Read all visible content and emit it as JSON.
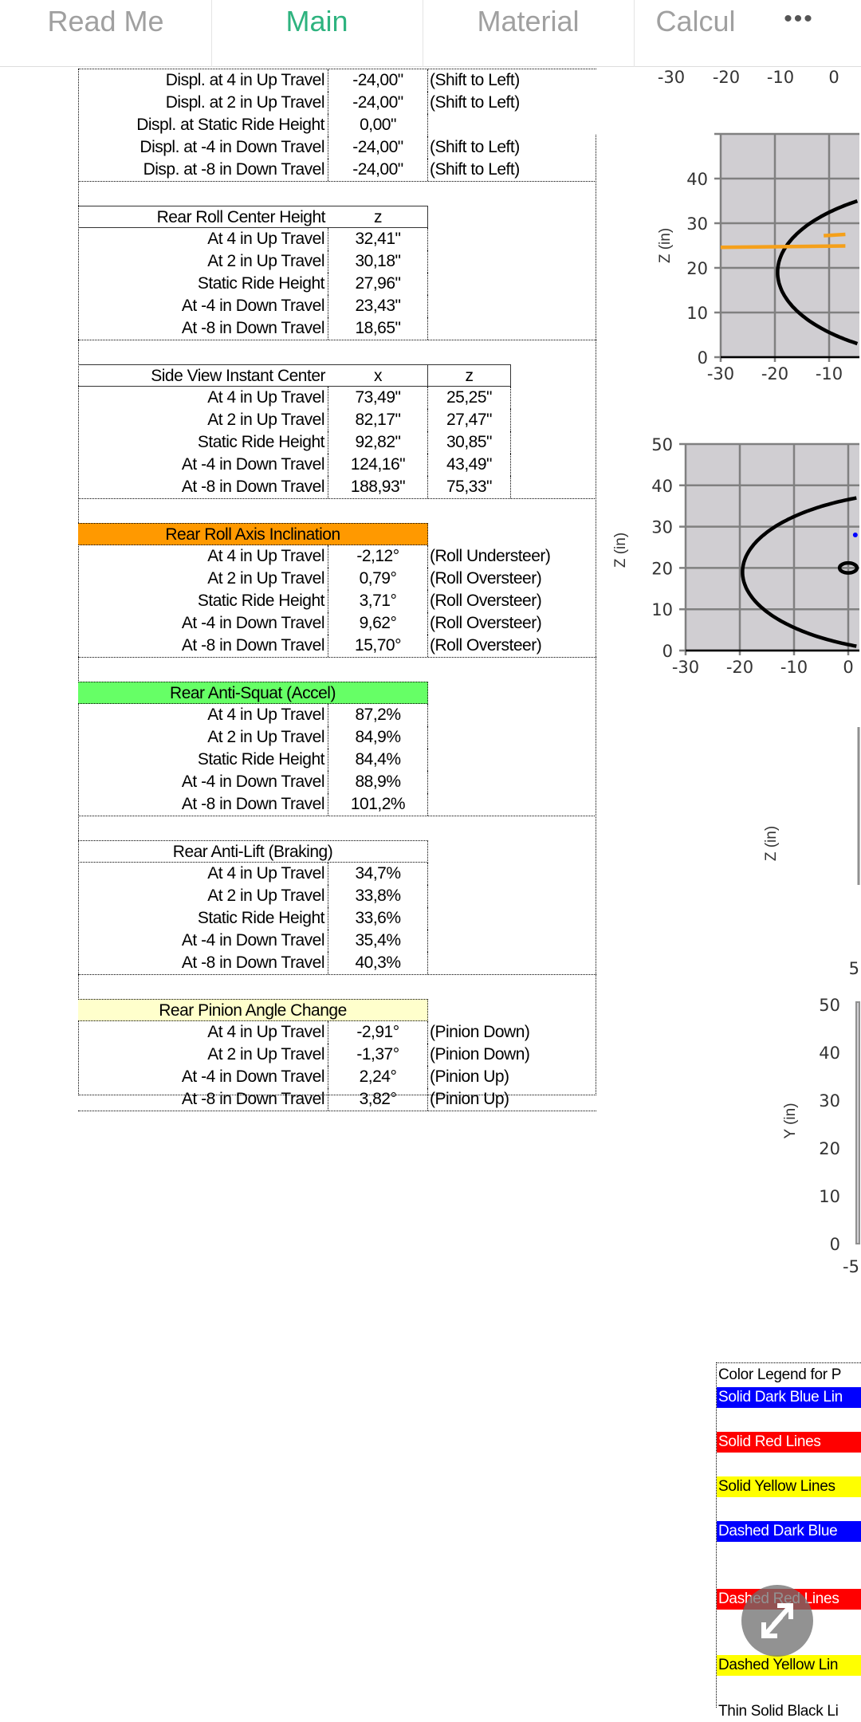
{
  "tabs": [
    {
      "label": "Read Me",
      "active": false
    },
    {
      "label": "Main",
      "active": true
    },
    {
      "label": "Material",
      "active": false
    },
    {
      "label": "Calcul",
      "active": false
    }
  ],
  "more_label": "•••",
  "colors": {
    "active_tab": "#2eb37f",
    "orange_header": "#ff9900",
    "green_header": "#66ff66",
    "yellow_header": "#ffffcc",
    "plot_bg": "#d0ced2",
    "orange_line": "#f5a01a"
  },
  "sections": [
    {
      "id": "lateral-displacement",
      "header": null,
      "rows": [
        {
          "label": "Displ. at 4 in Up Travel",
          "value": "-24,00\"",
          "comment": "(Shift to Left)"
        },
        {
          "label": "Displ. at 2 in Up Travel",
          "value": "-24,00\"",
          "comment": "(Shift to Left)"
        },
        {
          "label": "Displ. at Static Ride Height",
          "value": "0,00\"",
          "comment": ""
        },
        {
          "label": "Displ. at -4 in Down Travel",
          "value": "-24,00\"",
          "comment": "(Shift to Left)"
        },
        {
          "label": "Disp. at -8 in Down Travel",
          "value": "-24,00\"",
          "comment": "(Shift to Left)"
        }
      ]
    },
    {
      "id": "rear-roll-center-height",
      "header": {
        "title": "Rear Roll Center Height",
        "col1": "z",
        "bg": ""
      },
      "rows": [
        {
          "label": "At 4 in Up Travel",
          "value": "32,41\""
        },
        {
          "label": "At 2 in Up Travel",
          "value": "30,18\""
        },
        {
          "label": "Static Ride Height",
          "value": "27,96\""
        },
        {
          "label": "At -4 in Down Travel",
          "value": "23,43\""
        },
        {
          "label": "At -8 in Down Travel",
          "value": "18,65\""
        }
      ]
    },
    {
      "id": "side-view-instant-center",
      "header": {
        "title": "Side View Instant Center",
        "col1": "x",
        "col2": "z",
        "bg": ""
      },
      "rows": [
        {
          "label": "At 4 in Up Travel",
          "value": "73,49\"",
          "value2": "25,25\""
        },
        {
          "label": "At 2 in Up Travel",
          "value": "82,17\"",
          "value2": "27,47\""
        },
        {
          "label": "Static Ride Height",
          "value": "92,82\"",
          "value2": "30,85\""
        },
        {
          "label": "At -4 in Down Travel",
          "value": "124,16\"",
          "value2": "43,49\""
        },
        {
          "label": "At -8 in Down Travel",
          "value": "188,93\"",
          "value2": "75,33\""
        }
      ]
    },
    {
      "id": "rear-roll-axis-inclination",
      "header": {
        "title": "Rear Roll Axis Inclination",
        "bg": "#ff9900"
      },
      "rows": [
        {
          "label": "At 4 in Up Travel",
          "value": "-2,12°",
          "comment": "(Roll Understeer)"
        },
        {
          "label": "At 2 in Up Travel",
          "value": "0,79°",
          "comment": "(Roll Oversteer)"
        },
        {
          "label": "Static Ride Height",
          "value": "3,71°",
          "comment": "(Roll Oversteer)"
        },
        {
          "label": "At -4 in Down Travel",
          "value": "9,62°",
          "comment": "(Roll Oversteer)"
        },
        {
          "label": "At -8 in Down Travel",
          "value": "15,70°",
          "comment": "(Roll Oversteer)"
        }
      ]
    },
    {
      "id": "rear-anti-squat",
      "header": {
        "title": "Rear Anti-Squat (Accel)",
        "bg": "#66ff66"
      },
      "rows": [
        {
          "label": "At 4 in Up Travel",
          "value": "87,2%"
        },
        {
          "label": "At 2 in Up Travel",
          "value": "84,9%"
        },
        {
          "label": "Static Ride Height",
          "value": "84,4%"
        },
        {
          "label": "At -4 in Down Travel",
          "value": "88,9%"
        },
        {
          "label": "At -8 in Down Travel",
          "value": "101,2%"
        }
      ]
    },
    {
      "id": "rear-anti-lift",
      "header": {
        "title": "Rear Anti-Lift (Braking)",
        "bg": ""
      },
      "rows": [
        {
          "label": "At 4 in Up Travel",
          "value": "34,7%"
        },
        {
          "label": "At 2 in Up Travel",
          "value": "33,8%"
        },
        {
          "label": "Static Ride Height",
          "value": "33,6%"
        },
        {
          "label": "At -4 in Down Travel",
          "value": "35,4%"
        },
        {
          "label": "At -8 in Down Travel",
          "value": "40,3%"
        }
      ]
    },
    {
      "id": "rear-pinion-angle-change",
      "header": {
        "title": "Rear Pinion Angle Change",
        "bg": "#ffffcc"
      },
      "rows": [
        {
          "label": "At 4 in Up Travel",
          "value": "-2,91°",
          "comment": "(Pinion Down)"
        },
        {
          "label": "At 2 in Up Travel",
          "value": "-1,37°",
          "comment": "(Pinion Down)"
        },
        {
          "label": "At -4 in Down Travel",
          "value": "2,24°",
          "comment": "(Pinion Up)"
        },
        {
          "label": "At -8 in Down Travel",
          "value": "3,82°",
          "comment": "(Pinion Up)"
        }
      ]
    }
  ],
  "chart_data": [
    {
      "type": "line",
      "xticks": [
        "-30",
        "-20",
        "-10",
        "0"
      ],
      "note_visible": "x tick labels of chart above"
    },
    {
      "type": "line",
      "ylabel": "Z (in)",
      "xlim": [
        -30,
        -7
      ],
      "ylim": [
        0,
        50
      ],
      "xticks": [
        "-30",
        "-20",
        "-10"
      ],
      "yticks": [
        "0",
        "10",
        "20",
        "30",
        "40"
      ],
      "grid": true,
      "ellipse": {
        "cx": 15,
        "cy": 19,
        "rx": 34.5,
        "ry": 19.5
      },
      "lines": [
        {
          "color": "#f5a01a",
          "points": [
            [
              -30,
              24.6
            ],
            [
              -7,
              24.9
            ]
          ]
        },
        {
          "color": "#f5a01a",
          "points": [
            [
              -11,
              27.2
            ],
            [
              -7,
              27.5
            ]
          ]
        }
      ]
    },
    {
      "type": "line",
      "ylabel": "Z (in)",
      "xlim": [
        -30,
        0.5
      ],
      "ylim": [
        0,
        50
      ],
      "xticks": [
        "-30",
        "-20",
        "-10",
        "0"
      ],
      "yticks": [
        "0",
        "10",
        "20",
        "30",
        "40",
        "50"
      ],
      "grid": true,
      "ellipse": {
        "cx": 15,
        "cy": 19,
        "rx": 34.5,
        "ry": 19.5
      },
      "small_ellipse": {
        "cx": 0,
        "cy": 20,
        "rx": 1.6,
        "ry": 1.2
      },
      "points": [
        {
          "color": "#0000ff",
          "x": 1.3,
          "y": 28
        }
      ]
    },
    {
      "type": "line",
      "ylabel": "Z (in)",
      "xticks": [
        "5"
      ]
    },
    {
      "type": "line",
      "ylabel": "Y (in)",
      "ylim": [
        0,
        50
      ],
      "yticks": [
        "0",
        "10",
        "20",
        "30",
        "40",
        "50"
      ],
      "xticks": [
        "-5"
      ]
    }
  ],
  "legend": {
    "title": "Color Legend for P",
    "items": [
      {
        "label": "Solid Dark Blue Lin",
        "bg": "#0000ff",
        "fg": "#ffffff"
      },
      {
        "label": "Solid Red Lines",
        "bg": "#ff0000",
        "fg": "#ffffff"
      },
      {
        "label": "Solid Yellow Lines",
        "bg": "#ffff00",
        "fg": "#000000"
      },
      {
        "label": "Dashed Dark Blue",
        "bg": "#0000ff",
        "fg": "#ffffff"
      },
      {
        "label": "Dashed Red Lines",
        "bg": "#ff0000",
        "fg": "#ffffff"
      },
      {
        "label": "Dashed Yellow Lin",
        "bg": "#ffff00",
        "fg": "#000000"
      },
      {
        "label": "Thin Solid Black Li",
        "bg": "",
        "fg": "#000000"
      }
    ]
  },
  "fab_icon": "expand-arrows-icon"
}
